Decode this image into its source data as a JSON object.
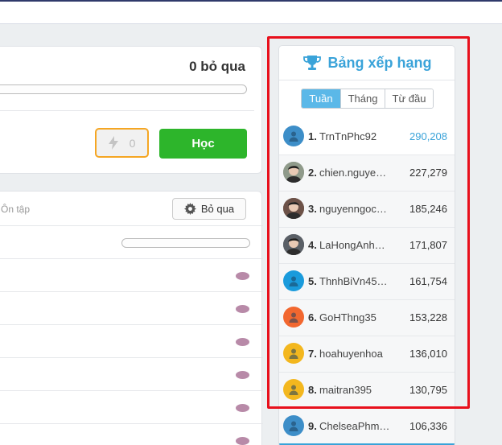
{
  "progress": {
    "skip_count_label": "0 bỏ qua",
    "boost_count": "0",
    "learn_label": "Học"
  },
  "review": {
    "label": "Ôn tập",
    "skip_label": "Bỏ qua"
  },
  "leaderboard": {
    "title": "Bảng xếp hạng",
    "tabs": [
      "Tuần",
      "Tháng",
      "Từ đầu"
    ],
    "active_tab": "Tuần",
    "accent_color": "#3aa3d9",
    "entries": [
      {
        "rank": "1.",
        "name": "TrnTnPhc92",
        "score": "290,208",
        "avatar": "person-icon",
        "avatar_color": "#3d8ec8"
      },
      {
        "rank": "2.",
        "name": "chien.nguye…",
        "score": "227,279",
        "avatar": "photo-avatar",
        "avatar_color": "#8f9a8a"
      },
      {
        "rank": "3.",
        "name": "nguyenngoc…",
        "score": "185,246",
        "avatar": "photo-avatar",
        "avatar_color": "#6d5248"
      },
      {
        "rank": "4.",
        "name": "LaHongAnh…",
        "score": "171,807",
        "avatar": "photo-avatar",
        "avatar_color": "#5a5f66"
      },
      {
        "rank": "5.",
        "name": "ThnhBiVn45…",
        "score": "161,754",
        "avatar": "person-icon",
        "avatar_color": "#1a9bdc"
      },
      {
        "rank": "6.",
        "name": "GoHThng35",
        "score": "153,228",
        "avatar": "person-icon",
        "avatar_color": "#f2672f"
      },
      {
        "rank": "7.",
        "name": "hoahuyenhoa",
        "score": "136,010",
        "avatar": "person-icon",
        "avatar_color": "#f3b71e"
      },
      {
        "rank": "8.",
        "name": "maitran395",
        "score": "130,795",
        "avatar": "person-icon",
        "avatar_color": "#f3b71e"
      },
      {
        "rank": "9.",
        "name": "ChelseaPhm…",
        "score": "106,336",
        "avatar": "person-icon",
        "avatar_color": "#3d8ec8"
      }
    ]
  },
  "colors": {
    "learn_button": "#2db52b",
    "boost_border": "#f5a623",
    "highlight": "#e8101c",
    "review_dot": "#b88aa8"
  }
}
